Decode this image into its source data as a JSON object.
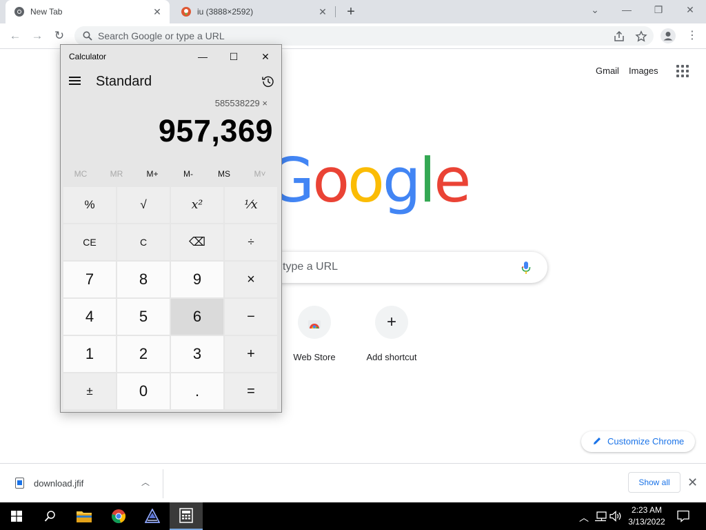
{
  "browser": {
    "tabs": [
      {
        "title": "New Tab",
        "active": true
      },
      {
        "title": "iu (3888×2592)",
        "active": false
      }
    ],
    "new_tab_symbol": "+",
    "omnibox_placeholder": "Search Google or type a URL",
    "window_controls": {
      "minimize": "—",
      "restore": "❐",
      "close": "✕",
      "tab_search": "⌄"
    }
  },
  "ntp": {
    "links": {
      "gmail": "Gmail",
      "images": "Images"
    },
    "logo": [
      "G",
      "o",
      "o",
      "g",
      "l",
      "e"
    ],
    "logo_colors": [
      "#4285f4",
      "#ea4335",
      "#fbbc05",
      "#4285f4",
      "#34a853",
      "#ea4335"
    ],
    "search_placeholder_visible": "type a URL",
    "shortcuts": [
      {
        "label": "Web Store",
        "icon": "web-store-icon"
      },
      {
        "label": "Add shortcut",
        "icon": "plus-icon",
        "symbol": "+"
      }
    ],
    "customize_label": "Customize Chrome"
  },
  "downloads": {
    "file_name": "download.jfif",
    "show_all": "Show all"
  },
  "calculator": {
    "window_title": "Calculator",
    "mode": "Standard",
    "expression": "585538229 ×",
    "display": "957,369",
    "memory": [
      {
        "label": "MC",
        "enabled": false
      },
      {
        "label": "MR",
        "enabled": false
      },
      {
        "label": "M+",
        "enabled": true
      },
      {
        "label": "M-",
        "enabled": true
      },
      {
        "label": "MS",
        "enabled": true
      },
      {
        "label": "M˅",
        "enabled": false
      }
    ],
    "keys": [
      [
        "%",
        "√",
        "x²",
        "¹⁄x"
      ],
      [
        "CE",
        "C",
        "⌫",
        "÷"
      ],
      [
        "7",
        "8",
        "9",
        "×"
      ],
      [
        "4",
        "5",
        "6",
        "−"
      ],
      [
        "1",
        "2",
        "3",
        "+"
      ],
      [
        "±",
        "0",
        ".",
        "="
      ]
    ]
  },
  "taskbar": {
    "time": "2:23 AM",
    "date": "3/13/2022",
    "items": [
      "start",
      "search",
      "file-explorer",
      "chrome",
      "app",
      "calculator"
    ]
  }
}
